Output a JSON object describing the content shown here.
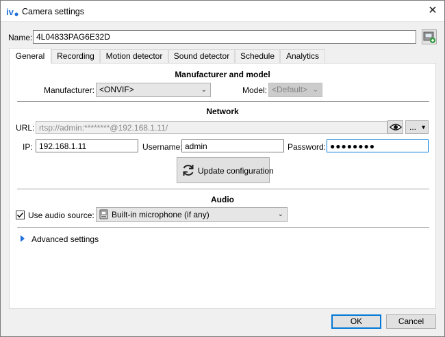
{
  "window": {
    "title": "Camera settings",
    "app_icon": "iv-logo-icon",
    "close_glyph": "✕"
  },
  "name_field": {
    "label": "Name:",
    "value": "4L04833PAG6E32D",
    "action_icon": "save-config-icon"
  },
  "tabs": [
    {
      "label": "General",
      "active": true
    },
    {
      "label": "Recording",
      "active": false
    },
    {
      "label": "Motion detector",
      "active": false
    },
    {
      "label": "Sound detector",
      "active": false
    },
    {
      "label": "Schedule",
      "active": false
    },
    {
      "label": "Analytics",
      "active": false
    }
  ],
  "general": {
    "manufacturer_section": {
      "title": "Manufacturer and model",
      "manufacturer_label": "Manufacturer:",
      "manufacturer_value": "<ONVIF>",
      "model_label": "Model:",
      "model_value": "<Default>"
    },
    "network_section": {
      "title": "Network",
      "url_label": "URL:",
      "url_value": "rtsp://admin:********@192.168.1.11/",
      "url_show_icon": "eye-icon",
      "url_more_label": "...",
      "ip_label": "IP:",
      "ip_value": "192.168.1.11",
      "username_label": "Username:",
      "username_value": "admin",
      "password_label": "Password:",
      "password_value": "●●●●●●●●",
      "update_button_label": "Update configuration",
      "update_icon": "refresh-icon"
    },
    "audio_section": {
      "title": "Audio",
      "use_audio_label": "Use audio source:",
      "use_audio_checked": true,
      "audio_source_value": "Built-in microphone (if any)",
      "audio_source_icon": "microphone-device-icon"
    },
    "advanced": {
      "label": "Advanced settings",
      "expanded": false
    }
  },
  "footer": {
    "ok_label": "OK",
    "cancel_label": "Cancel"
  },
  "colors": {
    "accent": "#0078d7",
    "window_bg": "#f0f0f0",
    "panel_bg": "#ffffff"
  }
}
